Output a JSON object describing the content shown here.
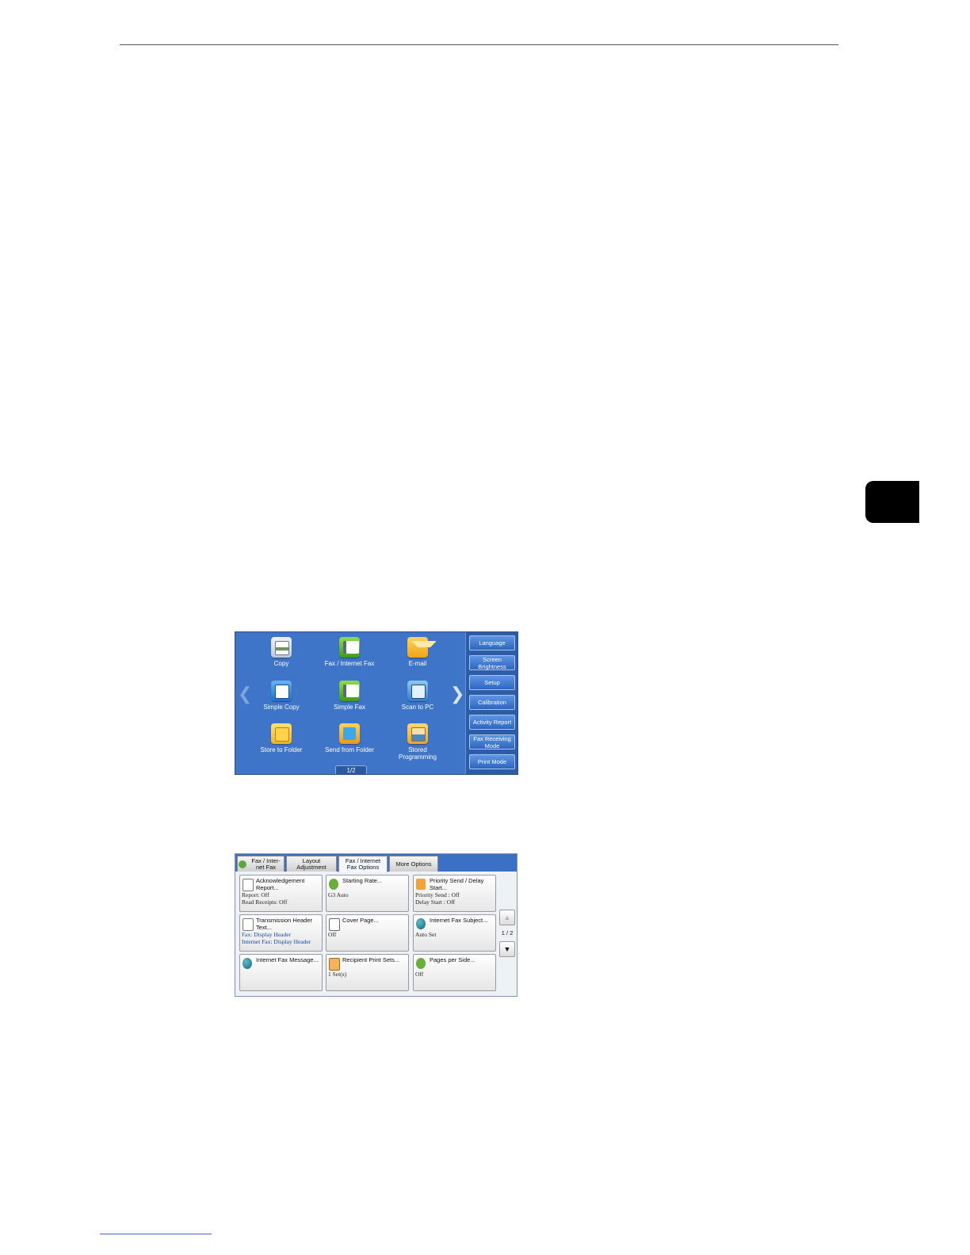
{
  "home": {
    "apps": [
      {
        "label": "Copy",
        "icon": "copy-icon"
      },
      {
        "label": "Fax / Internet Fax",
        "icon": "fax-icon"
      },
      {
        "label": "E-mail",
        "icon": "email-icon"
      },
      {
        "label": "Simple Copy",
        "icon": "simple-copy-icon"
      },
      {
        "label": "Simple Fax",
        "icon": "simple-fax-icon"
      },
      {
        "label": "Scan to PC",
        "icon": "scan-to-pc-icon"
      },
      {
        "label": "Store to Folder",
        "icon": "folder-icon"
      },
      {
        "label": "Send from Folder",
        "icon": "send-from-folder-icon"
      },
      {
        "label": "Stored Programming",
        "icon": "stored-programming-icon"
      }
    ],
    "page_indicator": "1/2",
    "side_buttons": [
      "Language",
      "Screen Brightness",
      "Setup",
      "Calibration",
      "Activity Report",
      "Fax Receiving Mode",
      "Print Mode"
    ]
  },
  "fax": {
    "tabs": [
      {
        "label": "Fax / Inter-net Fax",
        "active": false
      },
      {
        "label": "Layout Adjustment",
        "active": false
      },
      {
        "label": "Fax / Internet Fax Options",
        "active": true
      },
      {
        "label": "More Options",
        "active": false
      }
    ],
    "cards": [
      {
        "title": "Acknowledgement Report...",
        "values": [
          "Report: Off",
          "Read Receipts: Off"
        ],
        "icon": "report-icon",
        "blue": false
      },
      {
        "title": "Starting Rate...",
        "values": [
          "G3 Auto"
        ],
        "icon": "starting-rate-icon",
        "blue": false
      },
      {
        "title": "Priority Send / Delay Start...",
        "values": [
          "Priority Send : Off",
          "Delay Start : Off"
        ],
        "icon": "priority-send-icon",
        "blue": false
      },
      {
        "title": "Transmission Header Text...",
        "values": [
          "Fax: Display Header",
          "Internet Fax: Display Header"
        ],
        "icon": "header-text-icon",
        "blue": true
      },
      {
        "title": "Cover Page...",
        "values": [
          "Off"
        ],
        "icon": "cover-page-icon",
        "blue": false
      },
      {
        "title": "Internet Fax Subject...",
        "values": [
          "Auto Set"
        ],
        "icon": "internet-fax-subject-icon",
        "blue": false
      },
      {
        "title": "Internet Fax Message...",
        "values": [],
        "icon": "internet-fax-message-icon",
        "blue": false
      },
      {
        "title": "Recipient Print Sets...",
        "values": [
          "1 Set(s)"
        ],
        "icon": "recipient-print-sets-icon",
        "blue": false
      },
      {
        "title": "Pages per Side...",
        "values": [
          "Off"
        ],
        "icon": "pages-per-side-icon",
        "blue": false
      }
    ],
    "page_indicator": "1 / 2",
    "scroll_up": "▲",
    "scroll_down": "▼"
  }
}
